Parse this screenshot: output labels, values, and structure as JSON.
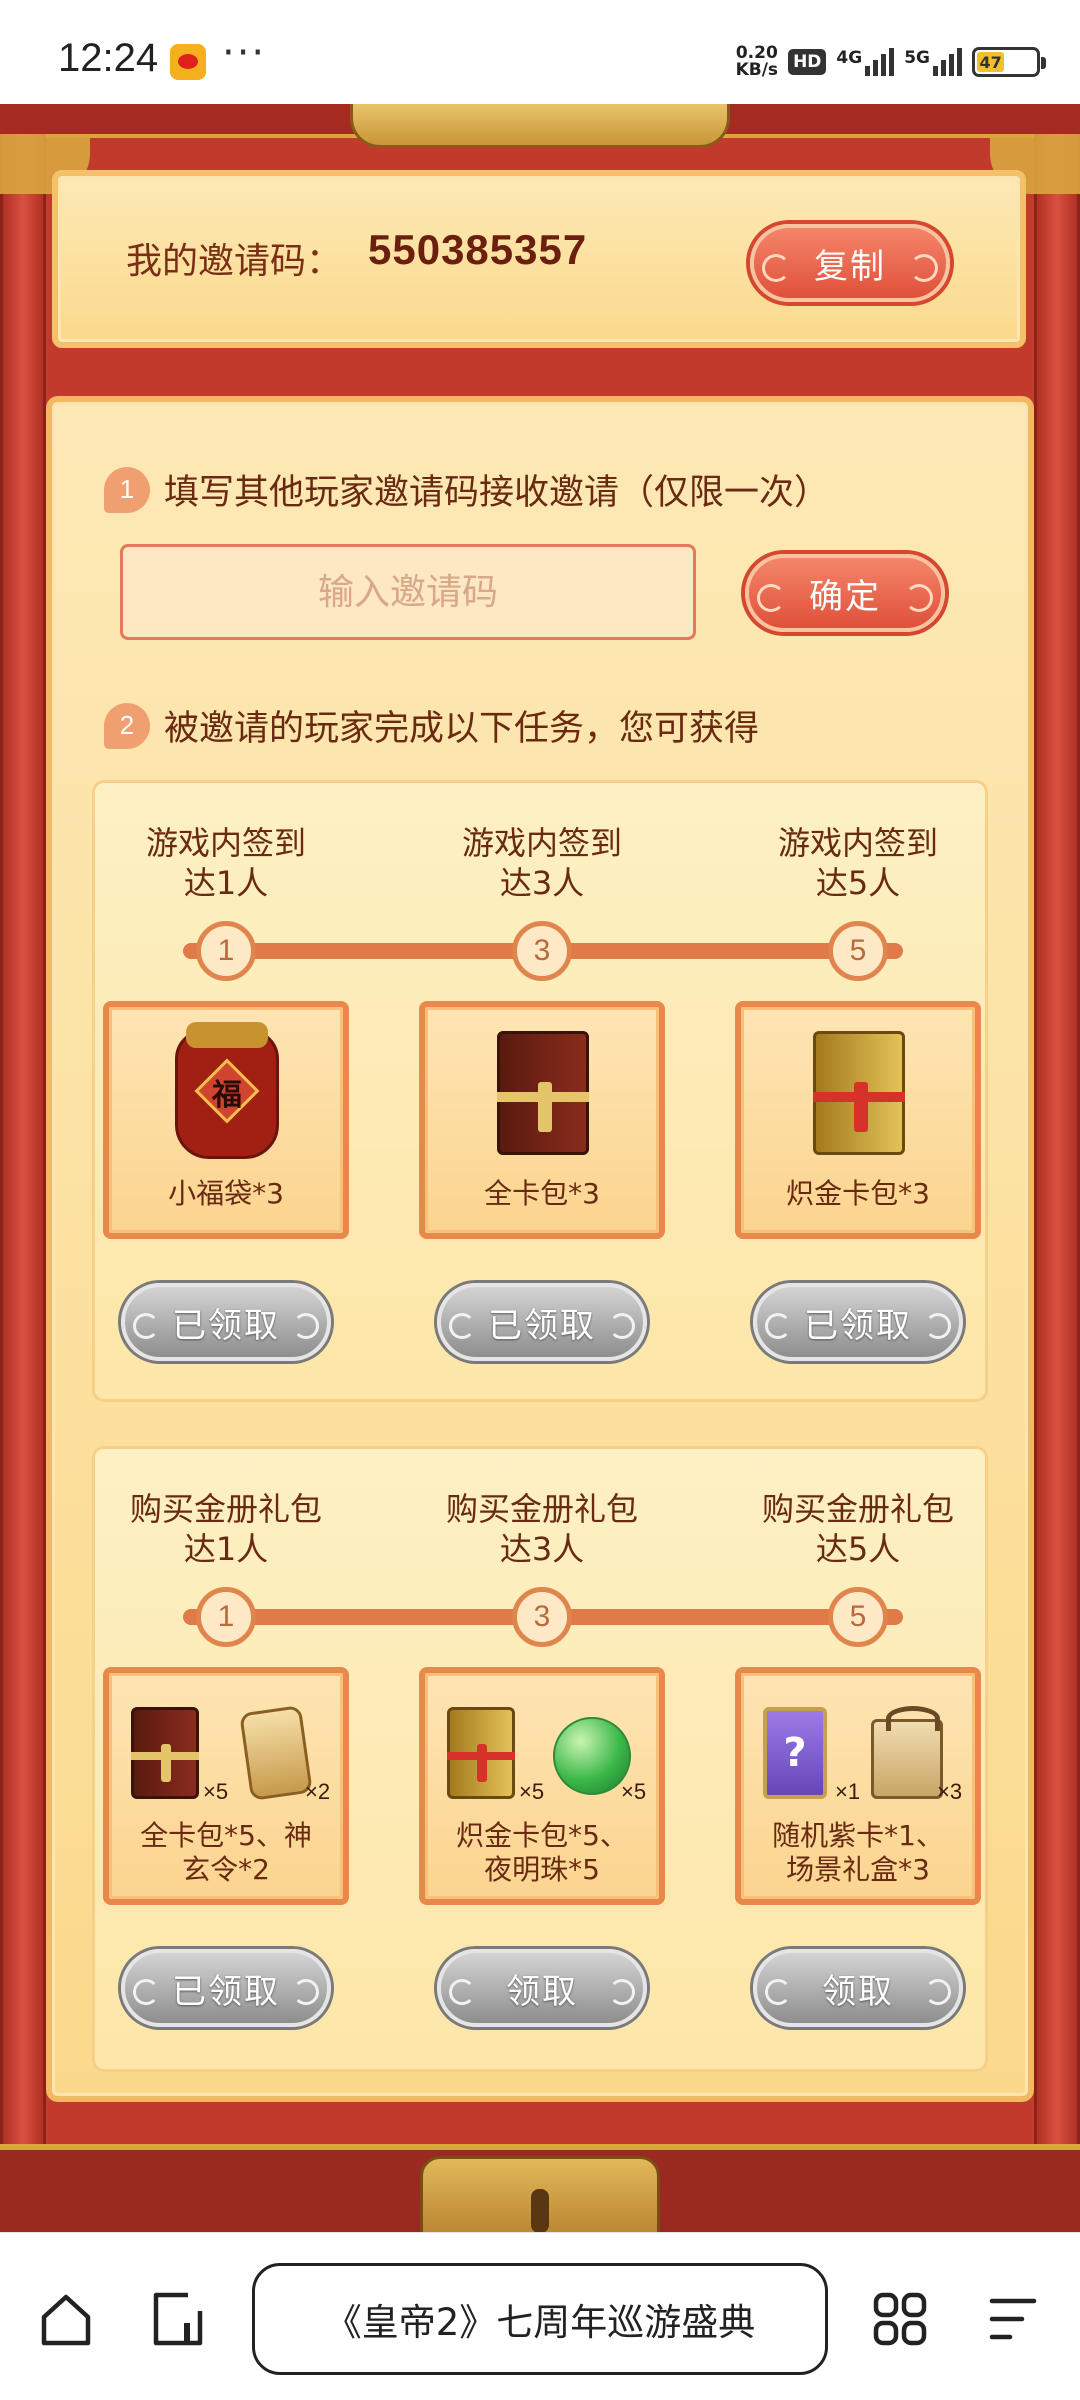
{
  "status_bar": {
    "time": "12:24",
    "dots": "···",
    "speed_value": "0.20",
    "speed_unit": "KB/s",
    "hd": "HD",
    "net1": "4G",
    "net2": "5G",
    "battery": "47"
  },
  "invite": {
    "label": "我的邀请码：",
    "code": "550385357",
    "copy_button": "复制"
  },
  "step1": {
    "number": "1",
    "text": "填写其他玩家邀请码接收邀请（仅限一次）",
    "input_placeholder": "输入邀请码",
    "confirm_button": "确定"
  },
  "step2": {
    "number": "2",
    "text": "被邀请的玩家完成以下任务，您可获得"
  },
  "task_group_1": {
    "milestones": [
      {
        "title": "游戏内签到\n达1人",
        "node": "1",
        "reward": "小福袋*3",
        "button": "已领取"
      },
      {
        "title": "游戏内签到\n达3人",
        "node": "3",
        "reward": "全卡包*3",
        "button": "已领取"
      },
      {
        "title": "游戏内签到\n达5人",
        "node": "5",
        "reward": "炽金卡包*3",
        "button": "已领取"
      }
    ]
  },
  "task_group_2": {
    "milestones": [
      {
        "title": "购买金册礼包\n达1人",
        "node": "1",
        "reward": "全卡包*5、神\n玄令*2",
        "qty_a": "×5",
        "qty_b": "×2",
        "button": "已领取"
      },
      {
        "title": "购买金册礼包\n达3人",
        "node": "3",
        "reward": "炽金卡包*5、\n夜明珠*5",
        "qty_a": "×5",
        "qty_b": "×5",
        "button": "领取"
      },
      {
        "title": "购买金册礼包\n达5人",
        "node": "5",
        "reward": "随机紫卡*1、\n场景礼盒*3",
        "qty_a": "×1",
        "qty_b": "×3",
        "button": "领取"
      }
    ]
  },
  "fu_char": "福",
  "mystery_char": "?",
  "browser": {
    "page_title": "《皇帝2》七周年巡游盛典"
  },
  "colors": {
    "frame_red": "#c23a2c",
    "panel_cream": "#fde9b6",
    "button_red": "#e0503a",
    "claimed_gray": "#8e8e8e",
    "text_brown": "#6a2a12"
  }
}
